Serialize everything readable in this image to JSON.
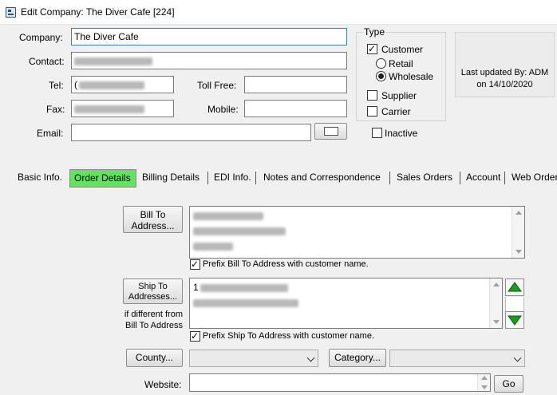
{
  "window": {
    "title": "Edit Company: The Diver Cafe [224]"
  },
  "form": {
    "company_label": "Company:",
    "company_value": "The Diver Cafe",
    "contact_label": "Contact:",
    "tel_label": "Tel:",
    "tel_value_prefix": "(",
    "tollfree_label": "Toll Free:",
    "fax_label": "Fax:",
    "mobile_label": "Mobile:",
    "email_label": "Email:"
  },
  "type_group": {
    "title": "Type",
    "customer_label": "Customer",
    "customer_checked": true,
    "retail_label": "Retail",
    "wholesale_label": "Wholesale",
    "selected_subtype": "Wholesale",
    "supplier_label": "Supplier",
    "supplier_checked": false,
    "carrier_label": "Carrier",
    "carrier_checked": false
  },
  "inactive": {
    "label": "Inactive",
    "checked": false
  },
  "last_updated": {
    "line1": "Last updated By: ADM",
    "line2": "on 14/10/2020"
  },
  "tabs": [
    {
      "label": "Basic Info."
    },
    {
      "label": "Order Details"
    },
    {
      "label": "Billing Details"
    },
    {
      "label": "EDI Info."
    },
    {
      "label": "Notes and Correspondence"
    },
    {
      "label": "Sales Orders"
    },
    {
      "label": "Account"
    },
    {
      "label": "Web Order"
    }
  ],
  "colors": {
    "highlight_tab": "#5ee45e",
    "arrow_green": "#1d9b1d"
  },
  "order_details": {
    "bill_to_button_line1": "Bill To",
    "bill_to_button_line2": "Address...",
    "prefix_bill_label": "Prefix Bill To Address with customer name.",
    "prefix_bill_checked": true,
    "ship_to_button_line1": "Ship To",
    "ship_to_button_line2": "Addresses...",
    "ship_note_line1": "if different from",
    "ship_note_line2": "Bill To Address",
    "ship_to_first_char": "1",
    "prefix_ship_label": "Prefix Ship To Address with customer name.",
    "prefix_ship_checked": true,
    "county_button": "County...",
    "category_button": "Category...",
    "website_label": "Website:",
    "go_button": "Go"
  }
}
